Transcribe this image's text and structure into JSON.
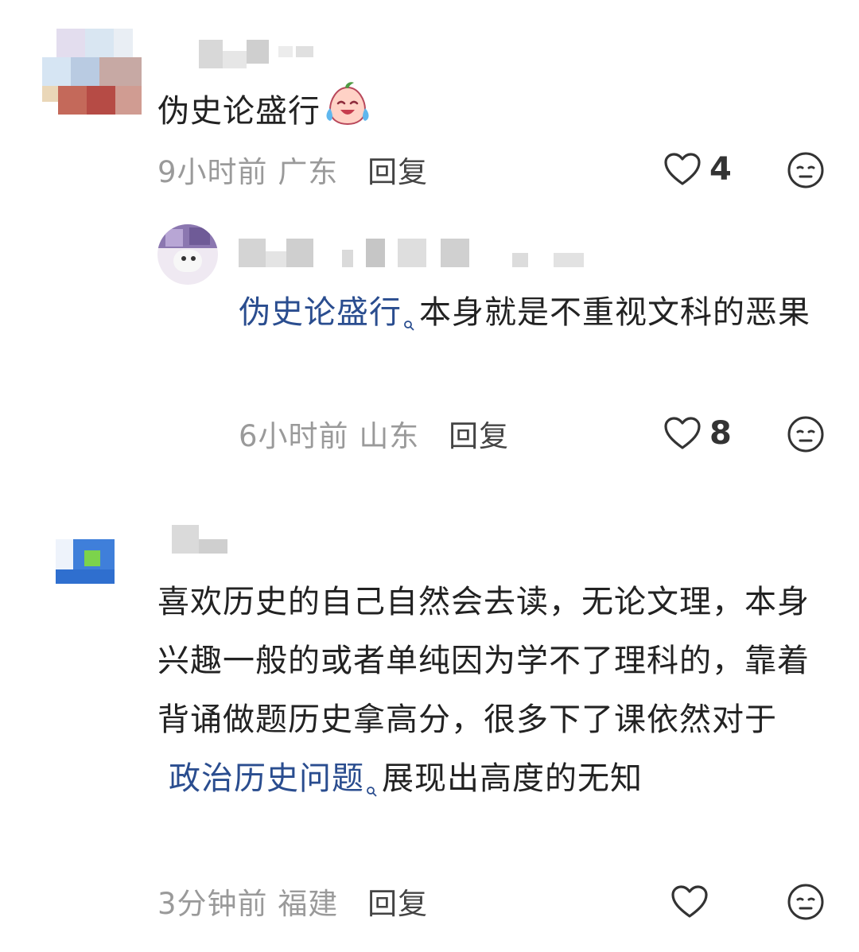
{
  "comments": [
    {
      "text": "伪史论盛行",
      "emoji": "crying-laughing-face-icon",
      "time": "9小时前",
      "location": "广东",
      "reply_label": "回复",
      "likes": "4"
    },
    {
      "link_text": "伪史论盛行",
      "text": "本身就是不重视文科的恶果",
      "time": "6小时前",
      "location": "山东",
      "reply_label": "回复",
      "likes": "8"
    },
    {
      "text_a": "喜欢历史的自己自然会去读，无论文理，本身兴趣一般的或者单纯因为学不了理科的，靠着背诵做题历史拿高分，很多下了课依然对于",
      "link_text": "政治历史问题",
      "text_b": "展现出高度的无知",
      "time": "3分钟前",
      "location": "福建",
      "reply_label": "回复",
      "likes": ""
    }
  ],
  "colors": {
    "link": "#2a4d8f",
    "meta": "#9a9a9a",
    "text": "#222222"
  }
}
